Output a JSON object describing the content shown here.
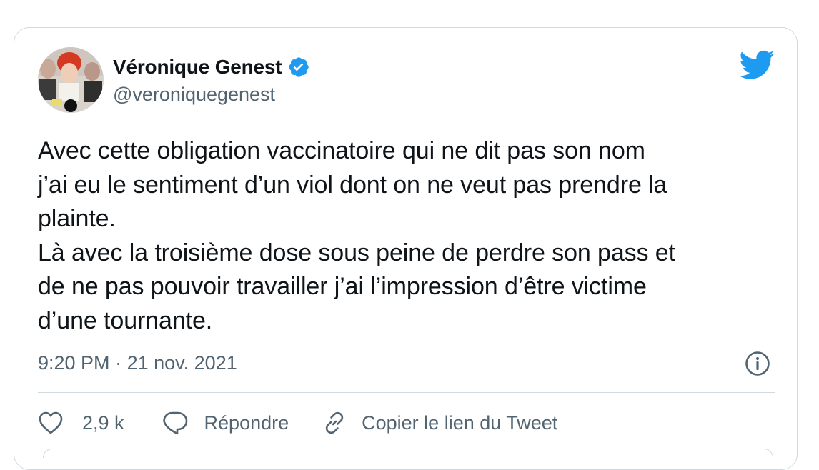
{
  "tweet": {
    "author": {
      "display_name": "Véronique Genest",
      "handle": "@veroniquegenest",
      "verified": true
    },
    "text_lines": [
      "Avec cette obligation vaccinatoire qui ne dit pas son nom",
      "j’ai eu le sentiment d’un viol dont on ne veut pas prendre la",
      "plainte.",
      "Là avec la troisième dose sous peine de perdre son pass et",
      "de ne pas pouvoir travailler j’ai l’impression d’être victime",
      "d’une tournante."
    ],
    "time": "9:20 PM",
    "separator": "·",
    "date": "21 nov. 2021",
    "actions": {
      "like_count": "2,9 k",
      "reply_label": "Répondre",
      "copy_link_label": "Copier le lien du Tweet"
    }
  },
  "icons": {
    "verified": "verified-badge-icon",
    "logo": "twitter-bird-icon",
    "info": "info-icon",
    "like": "heart-icon",
    "reply": "speech-bubble-icon",
    "copy_link": "link-icon"
  },
  "colors": {
    "brand_blue": "#1d9bf0",
    "text_primary": "#0f1419",
    "text_secondary": "#536471",
    "border": "#cfd9de"
  }
}
